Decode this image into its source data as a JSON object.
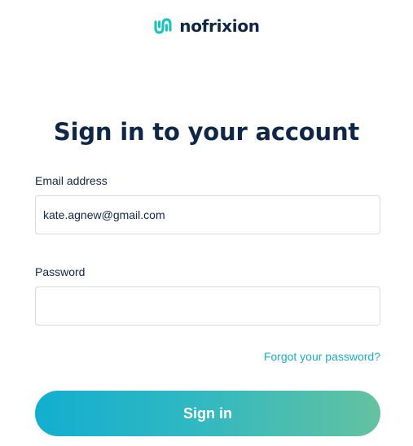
{
  "brand": {
    "name": "nofrixion",
    "accent_color": "#1fc1c3",
    "text_color": "#0f2747"
  },
  "title": "Sign in to your account",
  "form": {
    "email_label": "Email address",
    "email_value": "kate.agnew@gmail.com",
    "password_label": "Password",
    "password_value": "",
    "forgot_link": "Forgot your password?",
    "submit_label": "Sign in"
  }
}
